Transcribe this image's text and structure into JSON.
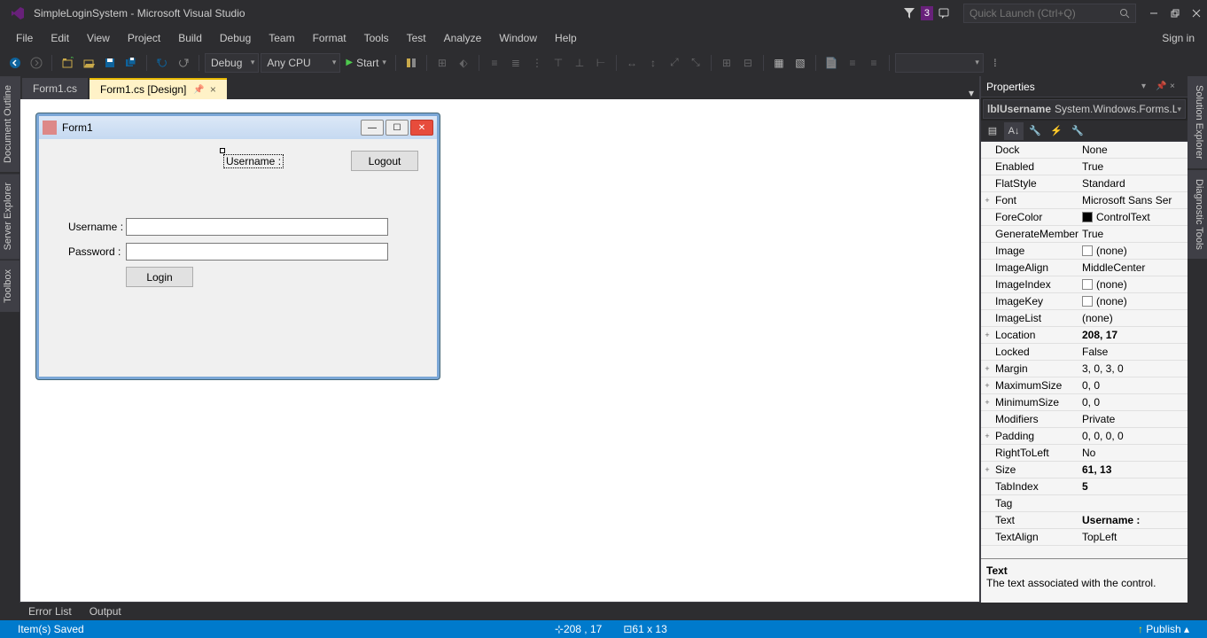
{
  "titlebar": {
    "title": "SimpleLoginSystem - Microsoft Visual Studio",
    "notification_count": "3",
    "quicklaunch_placeholder": "Quick Launch (Ctrl+Q)"
  },
  "menubar": {
    "items": [
      "File",
      "Edit",
      "View",
      "Project",
      "Build",
      "Debug",
      "Team",
      "Format",
      "Tools",
      "Test",
      "Analyze",
      "Window",
      "Help"
    ],
    "signin": "Sign in"
  },
  "toolbar": {
    "config": "Debug",
    "platform": "Any CPU",
    "start": "Start"
  },
  "vtabs_left": [
    "Document Outline",
    "Server Explorer",
    "Toolbox"
  ],
  "vtabs_right": [
    "Solution Explorer",
    "Diagnostic Tools"
  ],
  "doctabs": [
    {
      "label": "Form1.cs",
      "active": false
    },
    {
      "label": "Form1.cs [Design]",
      "active": true
    }
  ],
  "designer": {
    "form_title": "Form1",
    "lbl_username_top": "Username :",
    "btn_logout": "Logout",
    "lbl_username": "Username :",
    "lbl_password": "Password :",
    "btn_login": "Login"
  },
  "properties": {
    "panel_title": "Properties",
    "object_name": "lblUsername",
    "object_type": "System.Windows.Forms.L",
    "rows": [
      {
        "exp": "",
        "name": "Dock",
        "value": "None",
        "bold": false
      },
      {
        "exp": "",
        "name": "Enabled",
        "value": "True",
        "bold": false
      },
      {
        "exp": "",
        "name": "FlatStyle",
        "value": "Standard",
        "bold": false
      },
      {
        "exp": "+",
        "name": "Font",
        "value": "Microsoft Sans Ser",
        "bold": false
      },
      {
        "exp": "",
        "name": "ForeColor",
        "value": "ControlText",
        "bold": false,
        "swatch": "#000000"
      },
      {
        "exp": "",
        "name": "GenerateMember",
        "value": "True",
        "bold": false
      },
      {
        "exp": "",
        "name": "Image",
        "value": "(none)",
        "bold": false,
        "swatch": "#ffffff"
      },
      {
        "exp": "",
        "name": "ImageAlign",
        "value": "MiddleCenter",
        "bold": false
      },
      {
        "exp": "",
        "name": "ImageIndex",
        "value": "(none)",
        "bold": false,
        "swatch": "#ffffff"
      },
      {
        "exp": "",
        "name": "ImageKey",
        "value": "(none)",
        "bold": false,
        "swatch": "#ffffff"
      },
      {
        "exp": "",
        "name": "ImageList",
        "value": "(none)",
        "bold": false
      },
      {
        "exp": "+",
        "name": "Location",
        "value": "208, 17",
        "bold": true
      },
      {
        "exp": "",
        "name": "Locked",
        "value": "False",
        "bold": false
      },
      {
        "exp": "+",
        "name": "Margin",
        "value": "3, 0, 3, 0",
        "bold": false
      },
      {
        "exp": "+",
        "name": "MaximumSize",
        "value": "0, 0",
        "bold": false
      },
      {
        "exp": "+",
        "name": "MinimumSize",
        "value": "0, 0",
        "bold": false
      },
      {
        "exp": "",
        "name": "Modifiers",
        "value": "Private",
        "bold": false
      },
      {
        "exp": "+",
        "name": "Padding",
        "value": "0, 0, 0, 0",
        "bold": false
      },
      {
        "exp": "",
        "name": "RightToLeft",
        "value": "No",
        "bold": false
      },
      {
        "exp": "+",
        "name": "Size",
        "value": "61, 13",
        "bold": true
      },
      {
        "exp": "",
        "name": "TabIndex",
        "value": "5",
        "bold": true
      },
      {
        "exp": "",
        "name": "Tag",
        "value": "",
        "bold": false
      },
      {
        "exp": "",
        "name": "Text",
        "value": "Username :",
        "bold": true
      },
      {
        "exp": "",
        "name": "TextAlign",
        "value": "TopLeft",
        "bold": false
      }
    ],
    "desc_title": "Text",
    "desc_body": "The text associated with the control."
  },
  "bottom_tabs": [
    "Error List",
    "Output"
  ],
  "statusbar": {
    "left": "Item(s) Saved",
    "pos": "208 , 17",
    "size": "61 x 13",
    "publish": "Publish"
  }
}
